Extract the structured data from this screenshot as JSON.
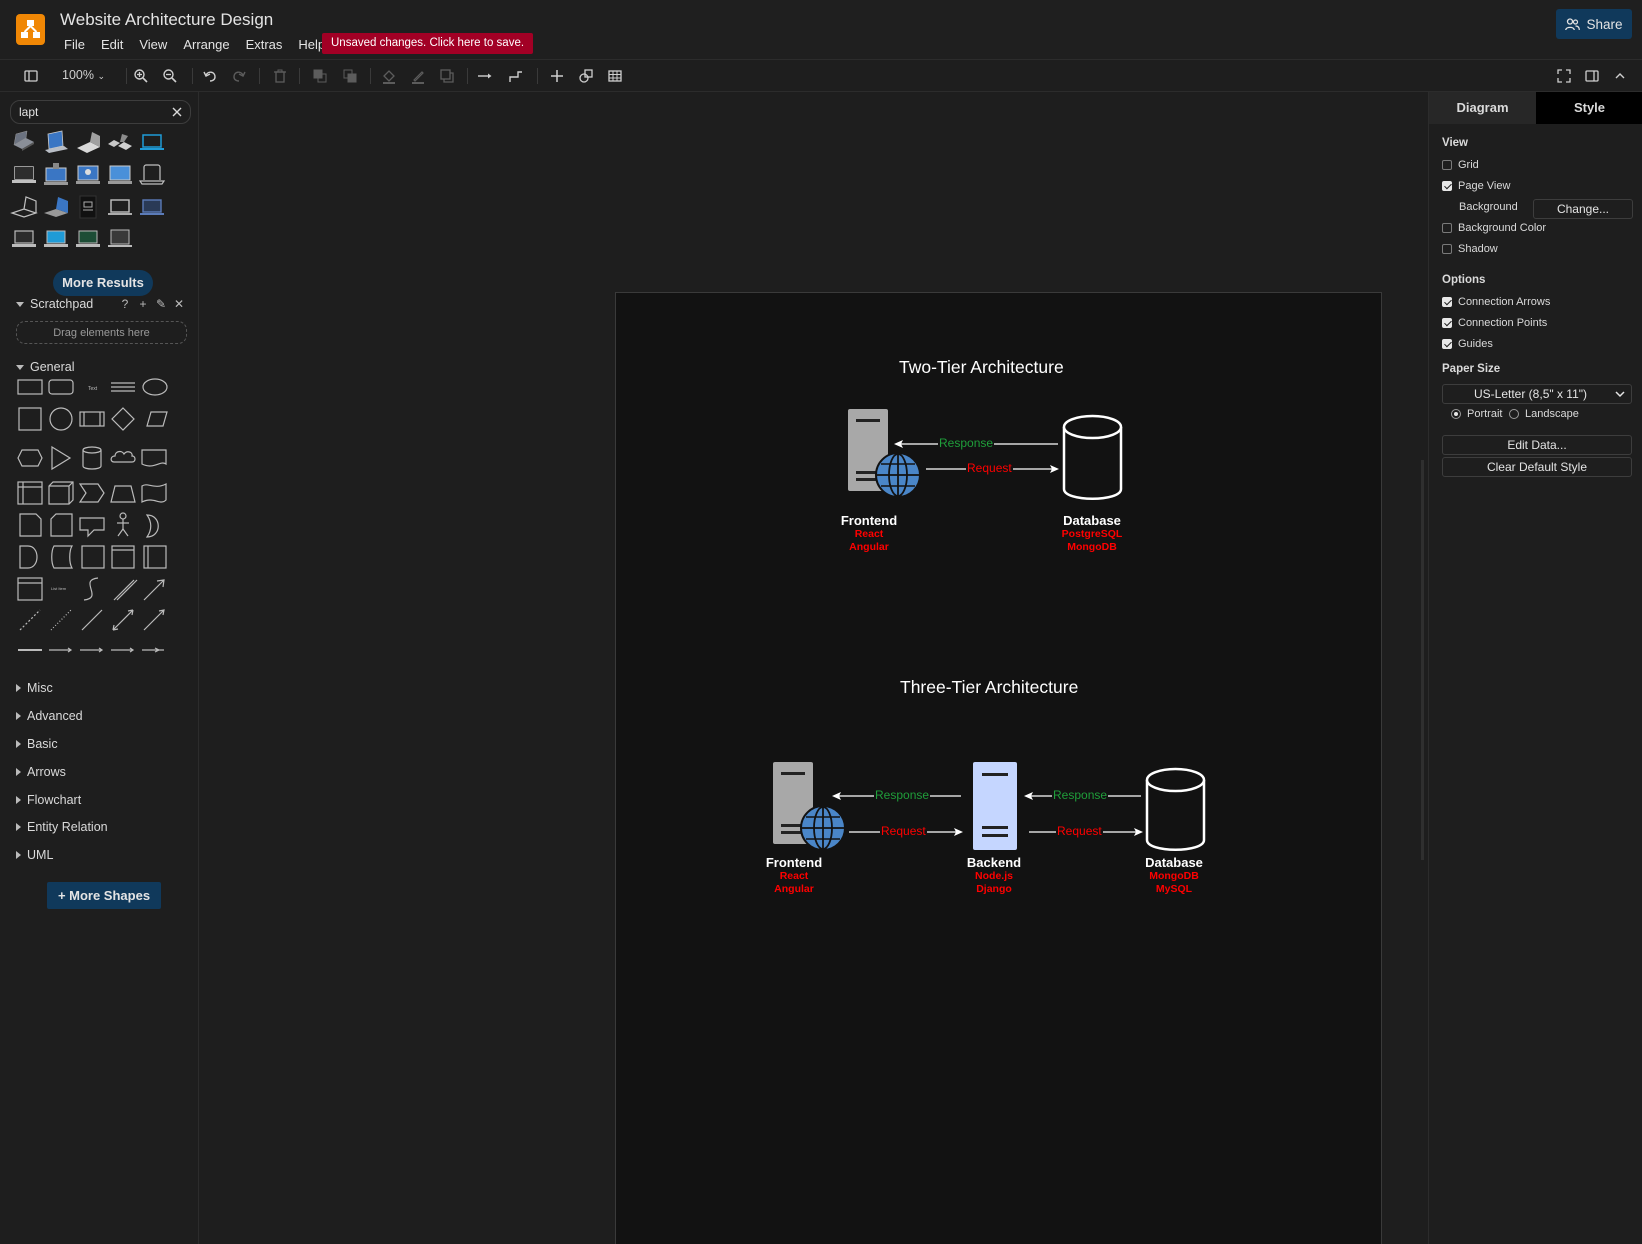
{
  "app": {
    "title": "Website Architecture Design",
    "menu": [
      "File",
      "Edit",
      "View",
      "Arrange",
      "Extras",
      "Help"
    ],
    "unsaved_notice": "Unsaved changes. Click here to save.",
    "share_label": "Share"
  },
  "toolbar": {
    "zoom": "100%"
  },
  "sidebar": {
    "search_value": "lapt",
    "more_results": "More Results",
    "scratchpad": {
      "title": "Scratchpad",
      "drop_hint": "Drag elements here"
    },
    "general": "General",
    "libraries": [
      "Misc",
      "Advanced",
      "Basic",
      "Arrows",
      "Flowchart",
      "Entity Relation",
      "UML"
    ],
    "more_shapes": "+ More Shapes"
  },
  "right_panel": {
    "tabs": [
      "Diagram",
      "Style"
    ],
    "view_title": "View",
    "grid": "Grid",
    "page_view": "Page View",
    "background": "Background",
    "change": "Change...",
    "background_color": "Background Color",
    "shadow": "Shadow",
    "options_title": "Options",
    "connection_arrows": "Connection Arrows",
    "connection_points": "Connection Points",
    "guides": "Guides",
    "paper_size_title": "Paper Size",
    "paper_size": "US-Letter (8,5\" x 11\")",
    "portrait": "Portrait",
    "landscape": "Landscape",
    "edit_data": "Edit Data...",
    "clear_default_style": "Clear Default Style"
  },
  "diagram": {
    "two_tier": {
      "title": "Two-Tier Architecture",
      "frontend": {
        "name": "Frontend",
        "tech": [
          "React",
          "Angular"
        ]
      },
      "database": {
        "name": "Database",
        "tech": [
          "PostgreSQL",
          "MongoDB"
        ]
      },
      "response": "Response",
      "request": "Request"
    },
    "three_tier": {
      "title": "Three-Tier Architecture",
      "frontend": {
        "name": "Frontend",
        "tech": [
          "React",
          "Angular"
        ]
      },
      "backend": {
        "name": "Backend",
        "tech": [
          "Node.js",
          "Django"
        ]
      },
      "database": {
        "name": "Database",
        "tech": [
          "MongoDB",
          "MySQL"
        ]
      },
      "response_1": "Response",
      "request_1": "Request",
      "response_2": "Response",
      "request_2": "Request"
    }
  },
  "colors": {
    "accent": "#10395b",
    "logo": "#f08705",
    "unsaved": "#a20025",
    "request": "#ff0000",
    "response": "#1f9e3a",
    "backend_fill": "#c5d6ff",
    "globe": "#4a86c8"
  }
}
